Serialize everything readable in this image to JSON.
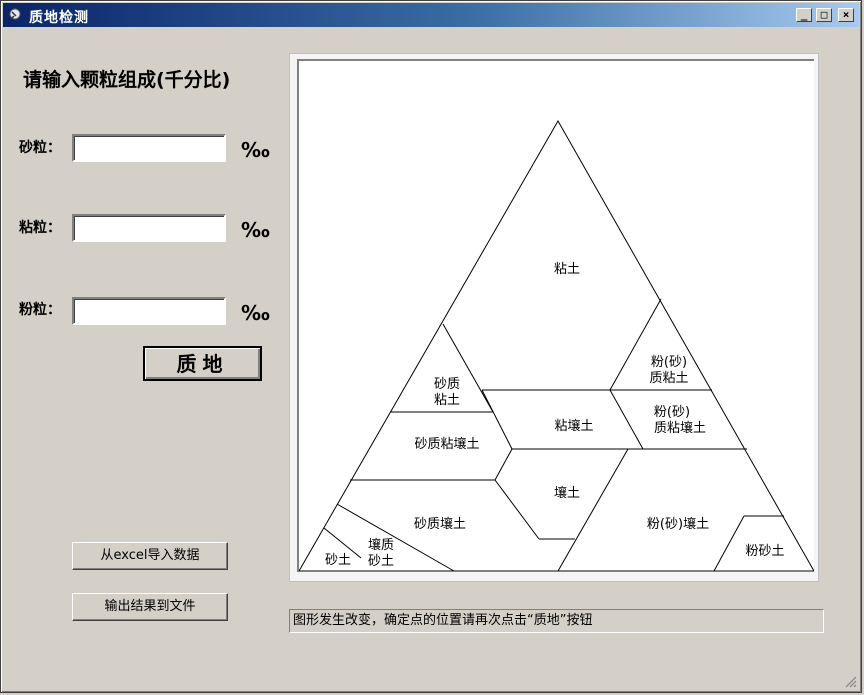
{
  "window": {
    "title": "质地检测",
    "min_btn": "_",
    "max_btn": "□",
    "close_btn": "×"
  },
  "form": {
    "heading": "请输入颗粒组成(千分比)",
    "sand_label": "砂粒：",
    "clay_label": "粘粒：",
    "silt_label": "粉粒：",
    "unit": "‰",
    "sand_value": "",
    "clay_value": "",
    "silt_value": "",
    "texture_button": "质地"
  },
  "actions": {
    "import_excel": "从excel导入数据",
    "export_file": "输出结果到文件"
  },
  "triangle": {
    "regions": {
      "clay": "粘土",
      "silty_clay_1": "粉(砂)",
      "silty_clay_2": "质粘土",
      "sandy_clay_1": "砂质",
      "sandy_clay_2": "粘土",
      "clay_loam": "粘壤土",
      "silty_clay_loam_1": "粉(砂)",
      "silty_clay_loam_2": "质粘壤土",
      "sandy_clay_loam": "砂质粘壤土",
      "loam": "壤土",
      "sandy_loam": "砂质壤土",
      "silt_loam": "粉(砂)壤土",
      "loamy_sand_1": "壤质",
      "loamy_sand_2": "砂土",
      "sand": "砂土",
      "silt": "粉砂土"
    }
  },
  "status": {
    "message": "图形发生改变，确定点的位置请再次点击“质地”按钮"
  }
}
